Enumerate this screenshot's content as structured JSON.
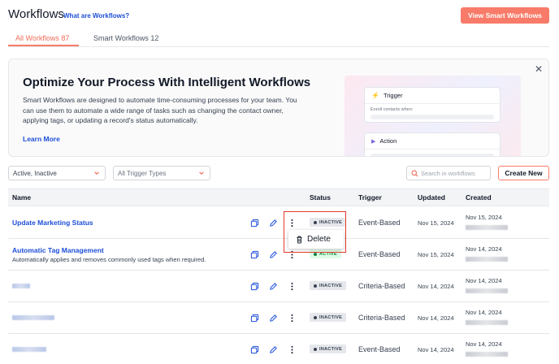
{
  "header": {
    "title": "Workflows",
    "help_link": "What are Workflows?",
    "smart_button": "View Smart Workflows"
  },
  "tabs": [
    {
      "label": "All Workflows 87",
      "active": true
    },
    {
      "label": "Smart Workflows 12",
      "active": false
    }
  ],
  "banner": {
    "title": "Optimize Your Process With Intelligent Workflows",
    "description": "Smart Workflows are designed to automate time-consuming processes for your team. You can use them to automate a wide range of tasks such as changing the contact owner, applying tags, or updating a record's status automatically.",
    "learn_more": "Learn More",
    "close_icon": "close-icon",
    "illustration": {
      "trigger_label": "Trigger",
      "trigger_sub": "Enroll contacts when:",
      "action_label": "Action"
    }
  },
  "filters": {
    "status_value": "Active, Inactive",
    "trigger_value": "All Trigger Types",
    "search_placeholder": "Search in workflows",
    "create_button": "Create New"
  },
  "table": {
    "columns": [
      "Name",
      "Status",
      "Trigger",
      "Updated",
      "Created"
    ],
    "rows": [
      {
        "name": "Update Marketing Status",
        "description": "",
        "status": "INACTIVE",
        "trigger": "Event-Based",
        "updated": "Nov 15, 2024",
        "created": "Nov 15, 2024"
      },
      {
        "name": "Automatic Tag Management",
        "description": "Automatically applies and removes commonly used tags when required.",
        "status": "ACTIVE",
        "trigger": "Event-Based",
        "updated": "Nov 15, 2024",
        "created": "Nov 14, 2024"
      },
      {
        "name": "",
        "description": "",
        "status": "INACTIVE",
        "trigger": "Criteria-Based",
        "updated": "Nov 14, 2024",
        "created": "Nov 14, 2024"
      },
      {
        "name": "",
        "description": "",
        "status": "INACTIVE",
        "trigger": "Criteria-Based",
        "updated": "Nov 14, 2024",
        "created": "Nov 14, 2024"
      },
      {
        "name": "",
        "description": "",
        "status": "INACTIVE",
        "trigger": "Event-Based",
        "updated": "Nov 14, 2024",
        "created": "Nov 14, 2024"
      }
    ]
  },
  "dropdown": {
    "delete_label": "Delete"
  },
  "colors": {
    "accent": "#f87b69",
    "link": "#1d4ed8",
    "highlight": "#e03b2a"
  }
}
